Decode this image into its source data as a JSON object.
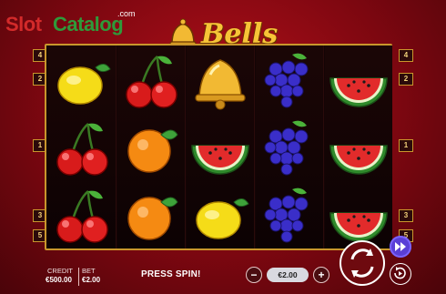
{
  "watermark": {
    "slot": "Slot",
    "catalog": "Catalog",
    "com": ".com"
  },
  "logo": {
    "text": "Bells"
  },
  "paylines_left": [
    "4",
    "2",
    "1",
    "3",
    "5"
  ],
  "paylines_right": [
    "4",
    "2",
    "1",
    "3",
    "5"
  ],
  "reels": [
    [
      "lemon",
      "cherry",
      "cherry"
    ],
    [
      "cherry",
      "orange",
      "orange"
    ],
    [
      "bell",
      "watermelon",
      "lemon"
    ],
    [
      "grapes",
      "grapes",
      "grapes"
    ],
    [
      "watermelon",
      "watermelon",
      "watermelon"
    ]
  ],
  "status": {
    "credit_label": "CREDIT",
    "credit_value": "€500.00",
    "bet_label": "BET",
    "bet_value": "€2.00",
    "message": "PRESS SPIN!"
  },
  "bet_control": {
    "minus": "−",
    "value": "€2.00",
    "plus": "+"
  },
  "buttons": {
    "spin": "spin-icon",
    "turbo": "fast-forward-icon",
    "autoplay": "autoplay-icon"
  },
  "colors": {
    "frame_gold": "#c9962c",
    "bg_red": "#b3101a",
    "turbo_purple": "#5a3fd6"
  }
}
